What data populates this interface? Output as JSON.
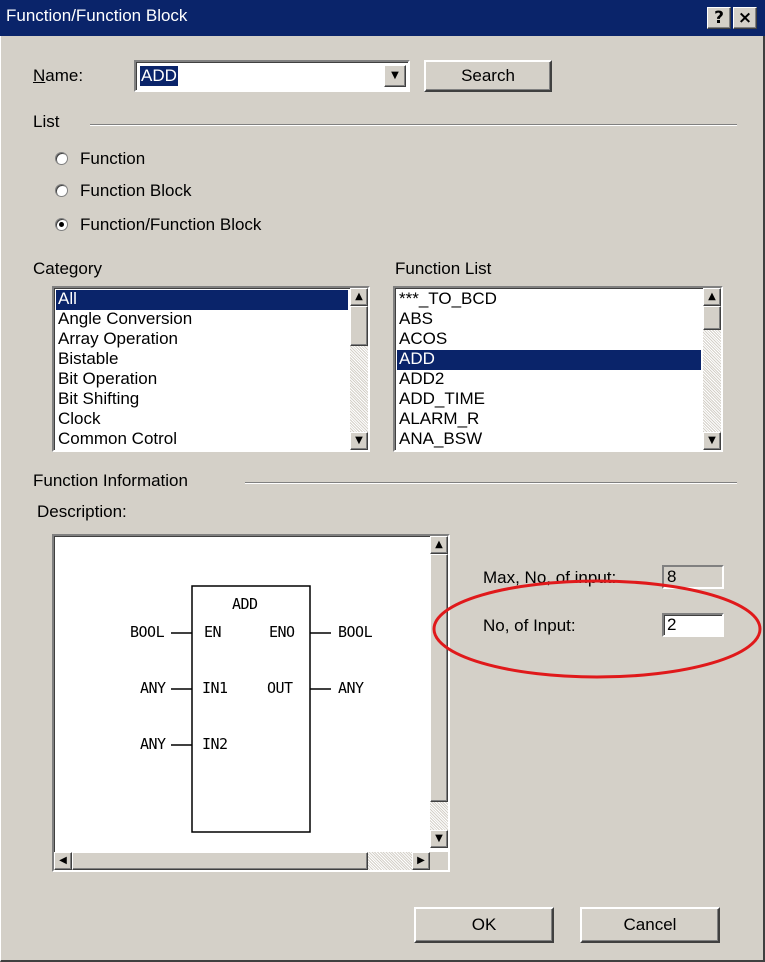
{
  "window": {
    "title": "Function/Function Block"
  },
  "caption_buttons": {
    "help": "?",
    "close": "×"
  },
  "name_row": {
    "label": "Name:",
    "value": "ADD",
    "search_label": "Search"
  },
  "list_group": {
    "label": "List",
    "options": [
      {
        "label": "Function",
        "selected": false
      },
      {
        "label": "Function Block",
        "selected": false
      },
      {
        "label": "Function/Function Block",
        "selected": true
      }
    ]
  },
  "category": {
    "label": "Category",
    "items": [
      "All",
      "Angle Conversion",
      "Array Operation",
      "Bistable",
      "Bit Operation",
      "Bit Shifting",
      "Clock",
      "Common Cotrol"
    ],
    "selected_index": 0
  },
  "function_list": {
    "label": "Function List",
    "items": [
      "***_TO_BCD",
      "ABS",
      "ACOS",
      "ADD",
      "ADD2",
      "ADD_TIME",
      "ALARM_R",
      "ANA_BSW"
    ],
    "selected_index": 3
  },
  "function_info": {
    "label": "Function Information",
    "description_label": "Description:",
    "block": {
      "name": "ADD",
      "inputs": [
        {
          "pin": "EN",
          "type": "BOOL"
        },
        {
          "pin": "IN1",
          "type": "ANY"
        },
        {
          "pin": "IN2",
          "type": "ANY"
        }
      ],
      "outputs": [
        {
          "pin": "ENO",
          "type": "BOOL"
        },
        {
          "pin": "OUT",
          "type": "ANY"
        }
      ]
    },
    "max_inputs_label": "Max, No, of input:",
    "max_inputs_value": "8",
    "num_inputs_label": "No, of Input:",
    "num_inputs_value": "2"
  },
  "footer": {
    "ok_label": "OK",
    "cancel_label": "Cancel"
  },
  "colors": {
    "dialog_bg": "#d4d0c8",
    "titlebar": "#0a246a",
    "selection": "#0a246a",
    "annotation_circle": "#e0191b"
  }
}
